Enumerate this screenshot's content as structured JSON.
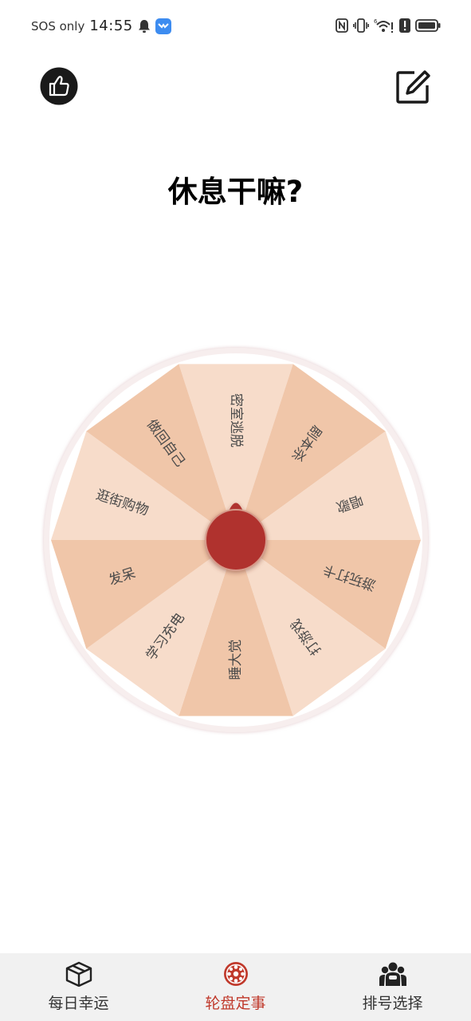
{
  "status_bar": {
    "carrier": "SOS only",
    "time": "14:55",
    "network_label": "6"
  },
  "header": {
    "like_icon": "thumbs-up-icon",
    "edit_icon": "edit-icon"
  },
  "title": "休息干嘛?",
  "wheel": {
    "segments": [
      "密室逃脱",
      "剧本杀",
      "唱歌",
      "游玩打卡",
      "打游戏",
      "睡大觉",
      "学习充电",
      "发呆",
      "逛街购物",
      "做回自己"
    ],
    "colors": {
      "light": "#f7dcca",
      "dark": "#f0c6a9",
      "pointer": "#b0302d",
      "rim": "#f7eeee"
    }
  },
  "bottom_nav": {
    "items": [
      {
        "label": "每日幸运",
        "icon": "box-icon"
      },
      {
        "label": "轮盘定事",
        "icon": "wheel-icon",
        "active": true
      },
      {
        "label": "排号选择",
        "icon": "group-icon"
      }
    ]
  }
}
